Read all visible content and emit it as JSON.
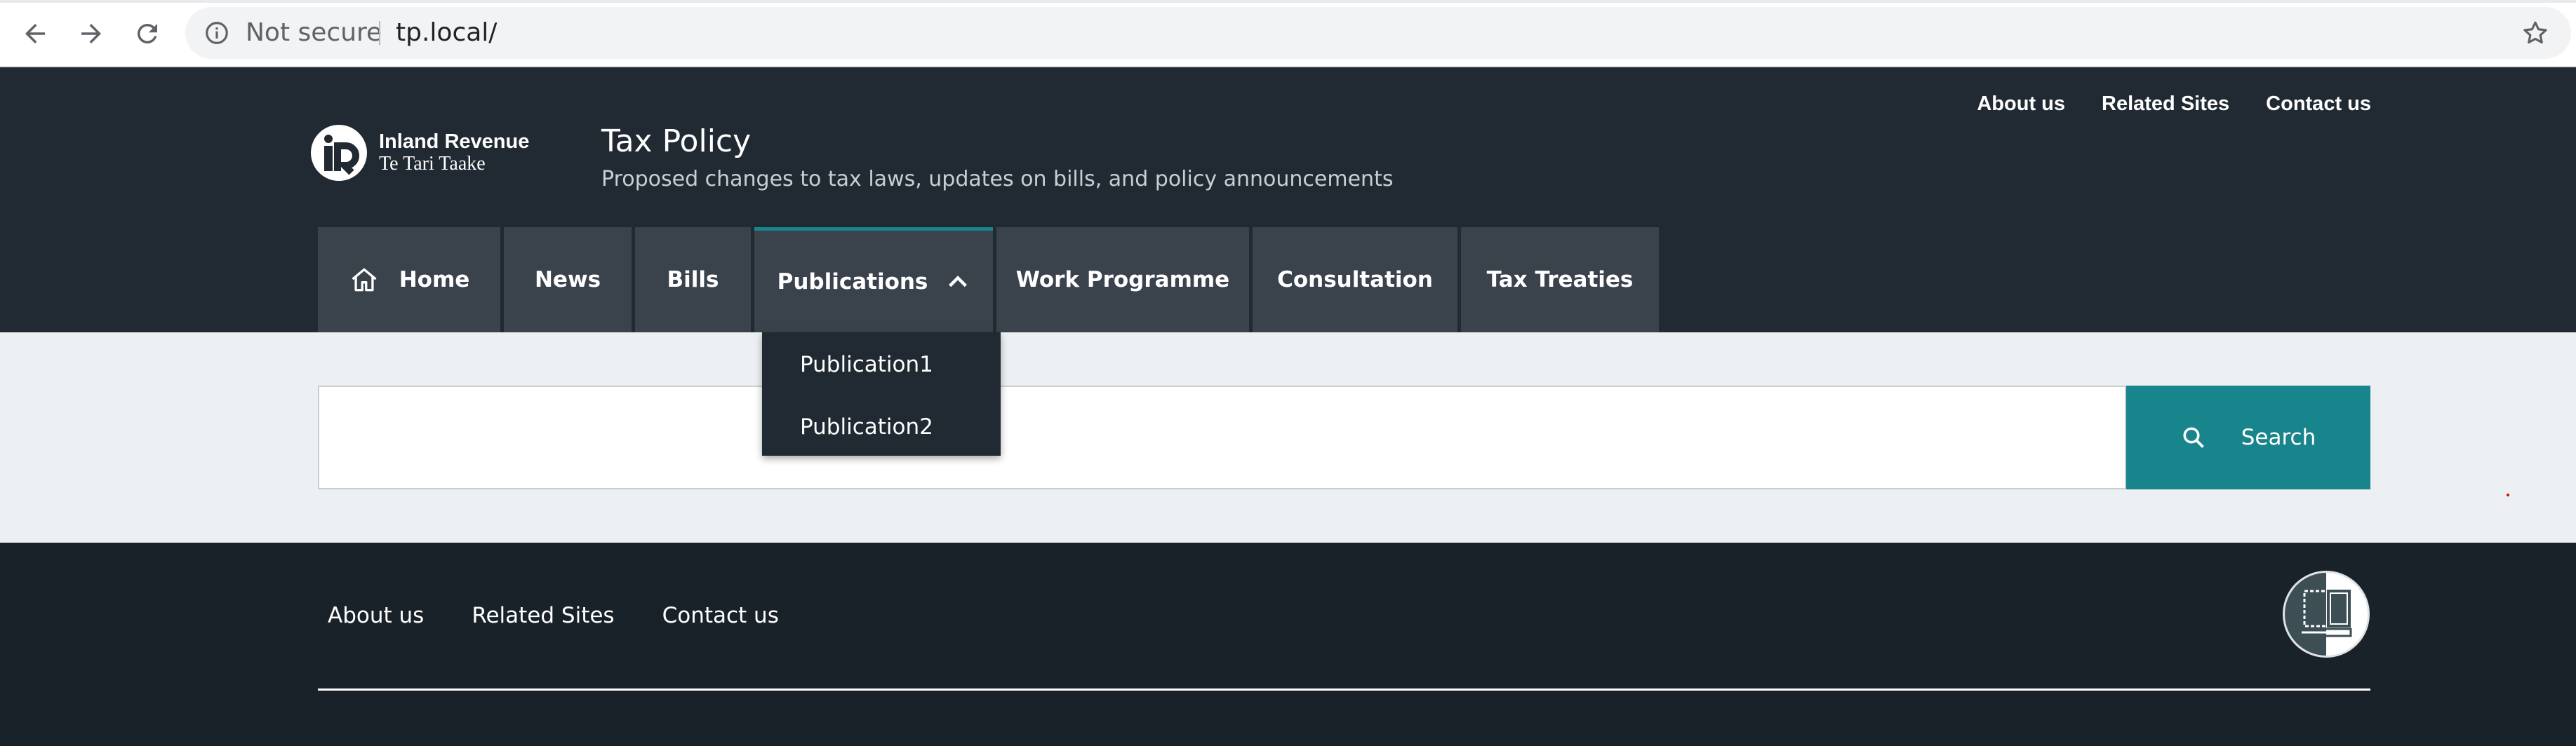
{
  "browser": {
    "security_label": "Not secure",
    "url": "tp.local/",
    "icons": [
      "back-arrow-icon",
      "forward-arrow-icon",
      "reload-icon",
      "info-icon",
      "star-icon"
    ]
  },
  "header": {
    "top_links": [
      "About us",
      "Related Sites",
      "Contact us"
    ],
    "logo": {
      "line1": "Inland Revenue",
      "line2": "Te Tari Taake"
    },
    "title": "Tax Policy",
    "subtitle": "Proposed changes to tax laws, updates on bills, and policy announcements"
  },
  "nav": {
    "items": [
      {
        "label": "Home",
        "icon": "home-icon"
      },
      {
        "label": "News"
      },
      {
        "label": "Bills"
      },
      {
        "label": "Publications",
        "icon": "chevron-up-icon",
        "active": true
      },
      {
        "label": "Work Programme"
      },
      {
        "label": "Consultation"
      },
      {
        "label": "Tax Treaties"
      }
    ],
    "dropdown": [
      "Publication1",
      "Publication2"
    ]
  },
  "search": {
    "value": "",
    "placeholder": "",
    "button_label": "Search"
  },
  "footer": {
    "links": [
      "About us",
      "Related Sites",
      "Contact us"
    ]
  },
  "colors": {
    "header_bg": "#212a32",
    "nav_item_bg": "#3a434c",
    "accent_teal": "#18848c",
    "search_band_bg": "#edf0f2",
    "footer_bg": "#1a2229"
  }
}
